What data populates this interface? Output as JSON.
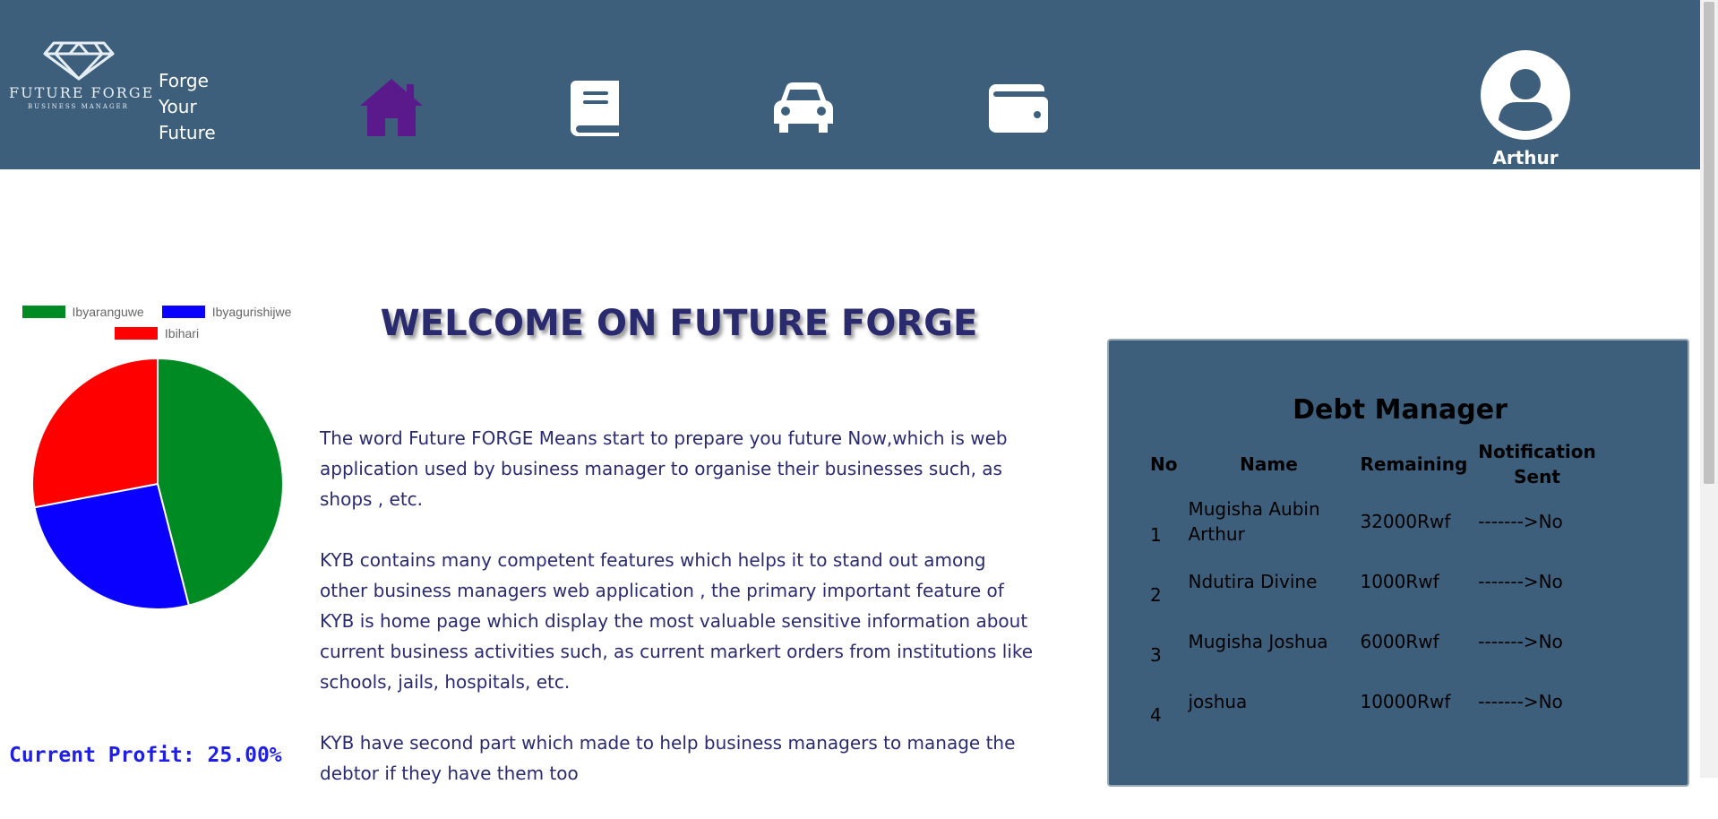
{
  "header": {
    "logo": {
      "brand": "FUTURE FORGE",
      "subtitle": "BUSINESS MANAGER",
      "icon": "diamond-logo-icon"
    },
    "slogan": [
      "Forge",
      "Your",
      "Future"
    ],
    "nav": [
      {
        "icon": "home-icon",
        "color": "#5b1a8c"
      },
      {
        "icon": "book-icon",
        "color": "#ffffff"
      },
      {
        "icon": "car-icon",
        "color": "#ffffff"
      },
      {
        "icon": "wallet-icon",
        "color": "#ffffff"
      }
    ],
    "user": {
      "name": "Arthur",
      "icon": "user-avatar-icon"
    },
    "background": "#3d5f7c"
  },
  "chart_data": {
    "type": "pie",
    "labels": [
      "Ibyaranguwe",
      "Ibyagurishijwe",
      "Ibihari"
    ],
    "values": [
      46,
      26,
      28
    ],
    "colors": [
      "#008a23",
      "#0a00ff",
      "#ff0000"
    ],
    "legend": "top"
  },
  "profit": {
    "label": "Current Profit: 25.00%"
  },
  "main": {
    "title": "WELCOME ON FUTURE FORGE",
    "paragraphs": [
      "The word Future FORGE Means start to prepare you future Now,which is web application used by business manager to organise their businesses such, as shops , etc.",
      "KYB contains many competent features which helps it to stand out among other business managers web application , the primary important feature of KYB is home page which display the most valuable sensitive information about current business activities such, as current markert orders from institutions like schools, jails, hospitals, etc.",
      "KYB have second part which made to help business managers to manage the debtor if they have them too"
    ]
  },
  "debt_manager": {
    "title": "Debt Manager",
    "columns": [
      "No",
      "Name",
      "Remaining",
      "Notification Sent"
    ],
    "rows": [
      {
        "no": "1",
        "name": "Mugisha Aubin Arthur",
        "remaining": "32000Rwf",
        "sent": "------->No"
      },
      {
        "no": "2",
        "name": "Ndutira Divine",
        "remaining": "1000Rwf",
        "sent": "------->No"
      },
      {
        "no": "3",
        "name": "Mugisha Joshua",
        "remaining": "6000Rwf",
        "sent": "------->No"
      },
      {
        "no": "4",
        "name": "joshua",
        "remaining": "10000Rwf",
        "sent": "------->No"
      }
    ]
  }
}
